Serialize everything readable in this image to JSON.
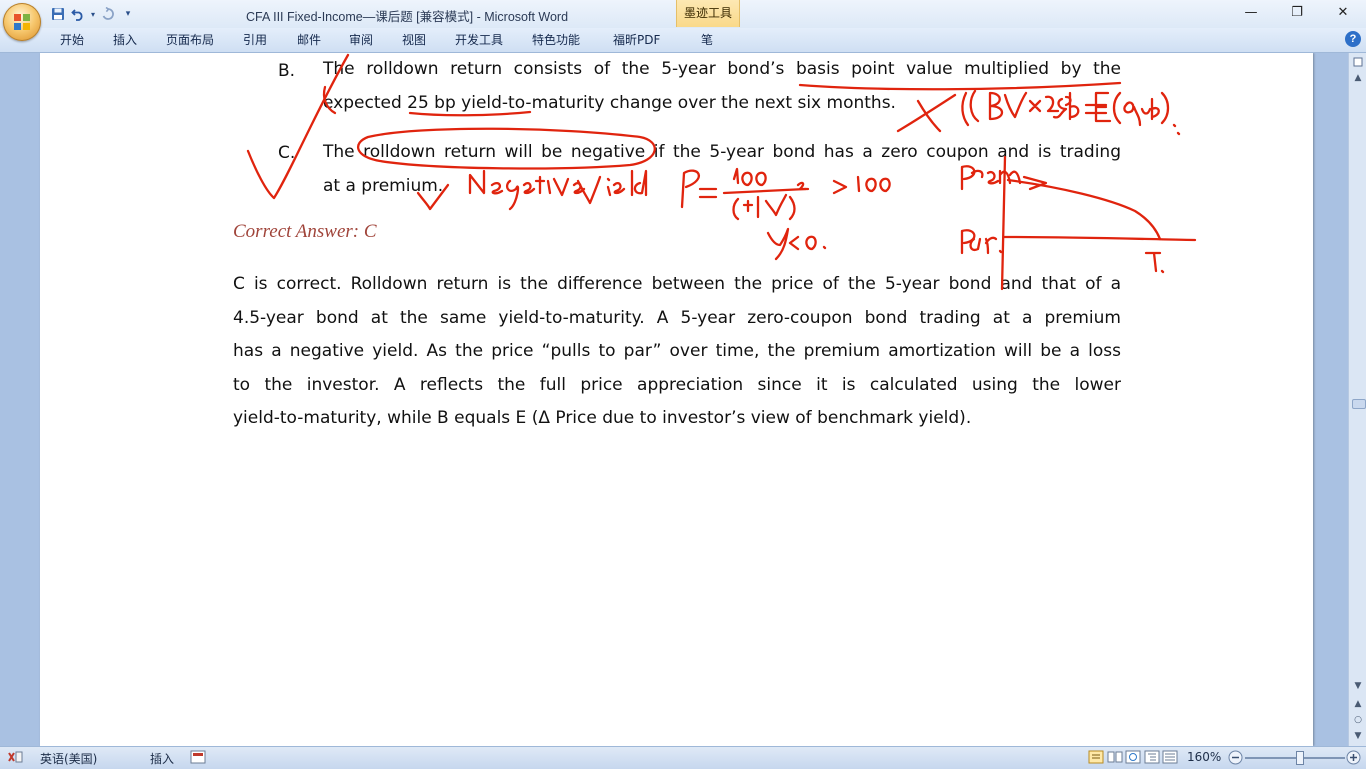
{
  "window": {
    "title": "CFA III Fixed-Income—课后题 [兼容模式] - Microsoft Word",
    "context_tab": "墨迹工具",
    "controls": {
      "minimize": "—",
      "maximize": "❐",
      "close": "✕"
    }
  },
  "quick_access": {
    "icons": [
      "save-icon",
      "undo-icon",
      "redo-icon",
      "customize-icon"
    ]
  },
  "ribbon": {
    "tabs": [
      "开始",
      "插入",
      "页面布局",
      "引用",
      "邮件",
      "审阅",
      "视图",
      "开发工具",
      "特色功能",
      "福昕PDF",
      "笔"
    ],
    "help": "?"
  },
  "document": {
    "option_b": {
      "letter": "B.",
      "lines": [
        "The rolldown return consists of the 5-year bond’s basis point value multiplied by the",
        "expected 25 bp yield-to-maturity change over the next six months."
      ]
    },
    "option_c": {
      "letter": "C.",
      "lines": [
        "The rolldown return will be negative if the 5-year bond has a zero coupon and is trading",
        "at a premium."
      ]
    },
    "correct_answer": "Correct Answer: C",
    "explanation_lines": [
      "C is correct. Rolldown return is the difference between the price of the 5-year bond and that of a",
      "4.5-year bond at the same yield-to-maturity. A 5-year zero-coupon bond trading at a premium",
      "has a negative yield. As the price “pulls to par” over time, the premium amortization will be a loss",
      "to the investor. A reflects the full price appreciation since it is calculated using the lower",
      "yield-to-maturity, while B equals E (Δ Price due to investor’s view of benchmark yield)."
    ],
    "ink_annotations": {
      "color": "#e0240e",
      "notes": [
        "(BPV×25bp = E(ΔyB).",
        "Negative yield",
        "P = 100/(1+y)^5 > 100",
        "y<0.",
        "Premium",
        "Par.",
        "T."
      ]
    }
  },
  "statusbar": {
    "language": "英语(美国)",
    "mode": "插入",
    "zoom": "160%",
    "zoom_level_percent": 160
  }
}
